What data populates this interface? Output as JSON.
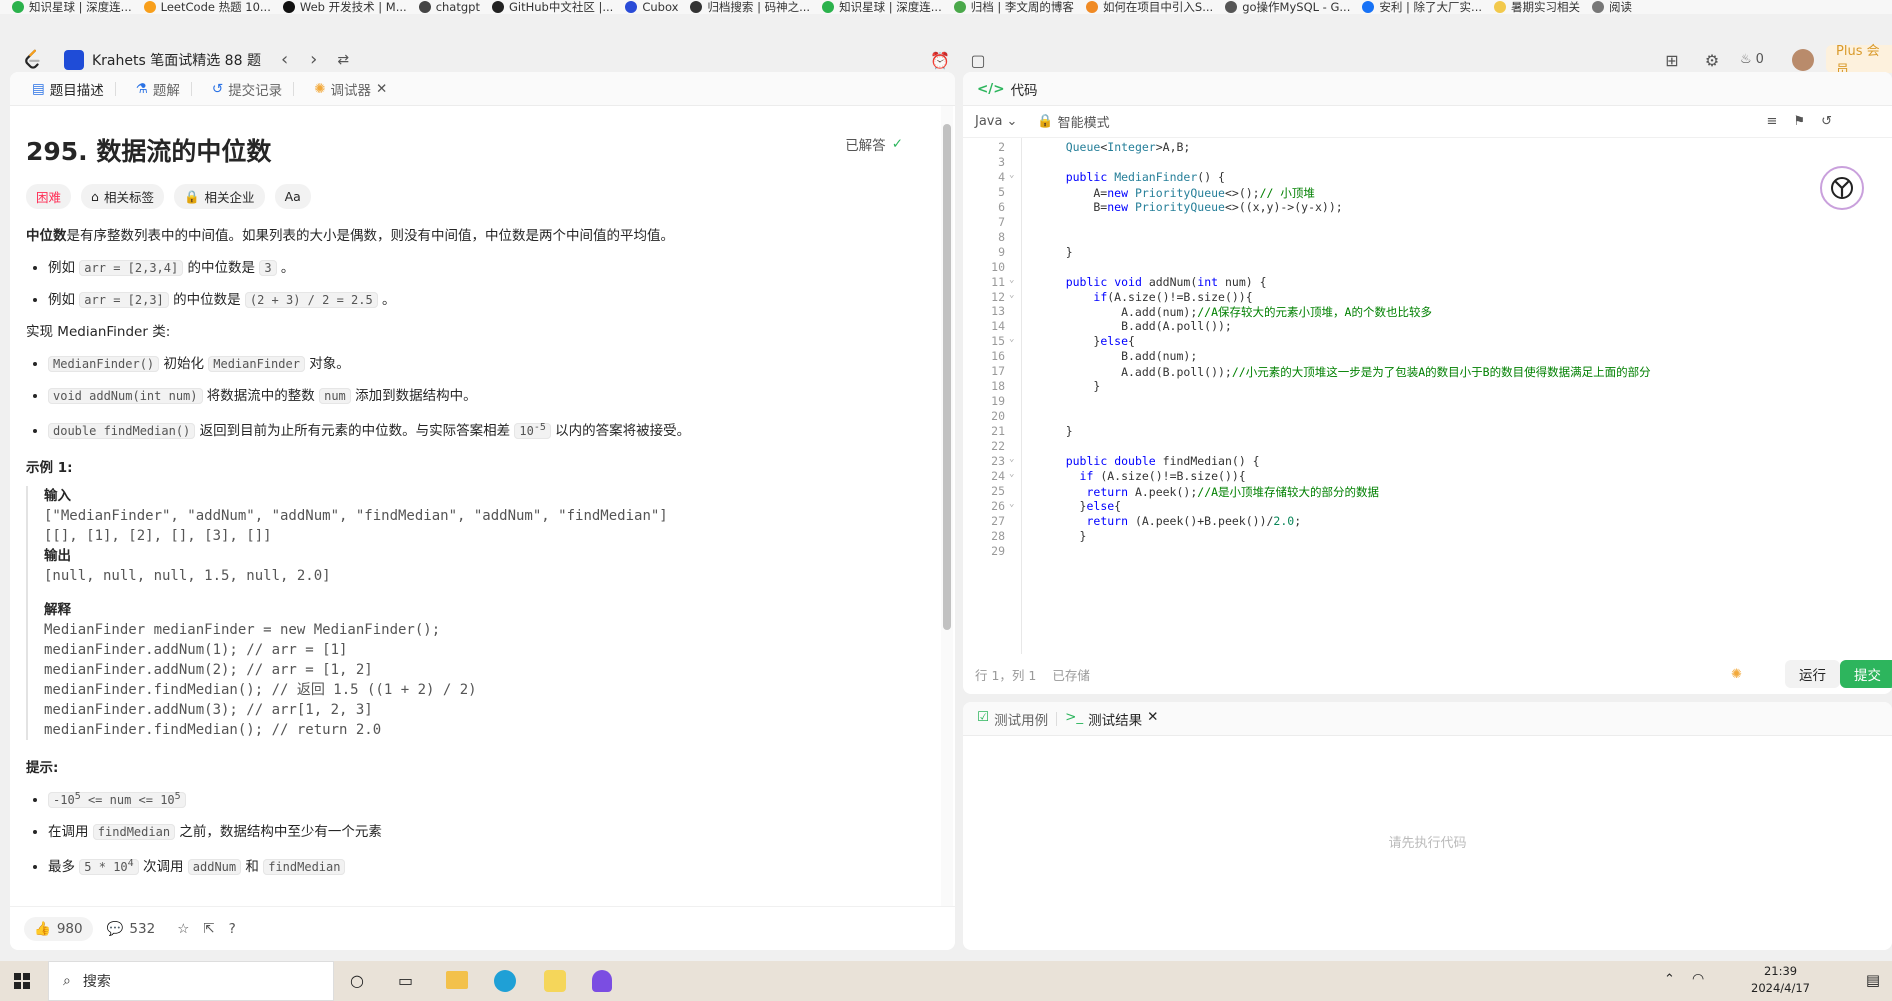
{
  "bookmarks": [
    {
      "label": "知识星球 | 深度连...",
      "color": "#2bb24c"
    },
    {
      "label": "LeetCode 热题 10...",
      "color": "#f89f1b"
    },
    {
      "label": "Web 开发技术 | M...",
      "color": "#111111"
    },
    {
      "label": "chatgpt",
      "color": "#444444"
    },
    {
      "label": "GitHub中文社区 |...",
      "color": "#222222"
    },
    {
      "label": "Cubox",
      "color": "#2a4bd7"
    },
    {
      "label": "归档搜索 | 码神之...",
      "color": "#333333"
    },
    {
      "label": "知识星球 | 深度连...",
      "color": "#2bb24c"
    },
    {
      "label": "归档 | 李文周的博客",
      "color": "#4aa84a"
    },
    {
      "label": "如何在项目中引入S...",
      "color": "#f08a24"
    },
    {
      "label": "go操作MySQL - G...",
      "color": "#555555"
    },
    {
      "label": "安利 | 除了大厂实...",
      "color": "#1772f6"
    },
    {
      "label": "暑期实习相关",
      "color": "#f2c94c"
    },
    {
      "label": "阅读",
      "color": "#777777"
    }
  ],
  "topnav": {
    "list_title": "Krahets 笔面试精选 88 题",
    "fire_count": "0",
    "plus_label": "Plus 会员"
  },
  "left_tabs": [
    {
      "label": "题目描述",
      "icon": "doc-icon"
    },
    {
      "label": "题解",
      "icon": "flask-icon"
    },
    {
      "label": "提交记录",
      "icon": "history-icon"
    },
    {
      "label": "调试器",
      "icon": "debug-icon"
    }
  ],
  "problem": {
    "title": "295. 数据流的中位数",
    "solved_label": "已解答",
    "difficulty": "困难",
    "chip_tags": "相关标签",
    "chip_company": "相关企业",
    "chip_font": "Aa",
    "intro_bold": "中位数",
    "intro_rest": "是有序整数列表中的中间值。如果列表的大小是偶数，则没有中间值，中位数是两个中间值的平均值。",
    "ex1_pre": "例如 ",
    "ex1_code": "arr = [2,3,4]",
    "ex1_mid": " 的中位数是 ",
    "ex1_val": "3",
    "ex1_end": " 。",
    "ex2_pre": "例如 ",
    "ex2_code": "arr = [2,3]",
    "ex2_mid": " 的中位数是 ",
    "ex2_val": "(2 + 3) / 2 = 2.5",
    "ex2_end": " 。",
    "impl_line": "实现 MedianFinder 类:",
    "m1_code": "MedianFinder()",
    "m1_text_a": " 初始化 ",
    "m1_code2": "MedianFinder",
    "m1_text_b": " 对象。",
    "m2_code": "void addNum(int num)",
    "m2_text_a": " 将数据流中的整数 ",
    "m2_code2": "num",
    "m2_text_b": " 添加到数据结构中。",
    "m3_code": "double findMedian()",
    "m3_text_a": " 返回到目前为止所有元素的中位数。与实际答案相差 ",
    "m3_code2": "10",
    "m3_sup": "-5",
    "m3_text_b": " 以内的答案将被接受。",
    "example_title": "示例 1:",
    "input_label": "输入",
    "input_line1": "[\"MedianFinder\", \"addNum\", \"addNum\", \"findMedian\", \"addNum\", \"findMedian\"]",
    "input_line2": "[[], [1], [2], [], [3], []]",
    "output_label": "输出",
    "output_line": "[null, null, null, 1.5, null, 2.0]",
    "explain_label": "解释",
    "explain_lines": [
      "MedianFinder medianFinder = new MedianFinder();",
      "medianFinder.addNum(1);    // arr = [1]",
      "medianFinder.addNum(2);    // arr = [1, 2]",
      "medianFinder.findMedian(); // 返回 1.5 ((1 + 2) / 2)",
      "medianFinder.addNum(3);    // arr[1, 2, 3]",
      "medianFinder.findMedian(); // return 2.0"
    ],
    "hints_title": "提示:",
    "h1_a": "-10",
    "h1_sup": "5",
    "h1_b": " <= num <= 10",
    "h1_sup2": "5",
    "h2_pre": "在调用 ",
    "h2_code": "findMedian",
    "h2_post": " 之前，数据结构中至少有一个元素",
    "h3_pre": "最多 ",
    "h3_code": "5 * 10",
    "h3_sup": "4",
    "h3_mid": " 次调用 ",
    "h3_code2": "addNum",
    "h3_and": " 和 ",
    "h3_code3": "findMedian"
  },
  "left_footer": {
    "likes": "980",
    "comments": "532"
  },
  "code_panel": {
    "title": "代码",
    "language": "Java",
    "mode": "智能模式",
    "status_pos": "行 1，列 1",
    "status_saved": "已存储",
    "run_label": "运行",
    "submit_label": "提交"
  },
  "code_lines": [
    {
      "n": "2",
      "t": "    Queue<Integer>A,B;"
    },
    {
      "n": "3",
      "t": ""
    },
    {
      "n": "4",
      "t": "    public MedianFinder() {",
      "fold": true
    },
    {
      "n": "5",
      "t": "        A=new PriorityQueue<>();// 小顶堆"
    },
    {
      "n": "6",
      "t": "        B=new PriorityQueue<>((x,y)->(y-x));"
    },
    {
      "n": "7",
      "t": ""
    },
    {
      "n": "8",
      "t": ""
    },
    {
      "n": "9",
      "t": "    }"
    },
    {
      "n": "10",
      "t": ""
    },
    {
      "n": "11",
      "t": "    public void addNum(int num) {",
      "fold": true
    },
    {
      "n": "12",
      "t": "        if(A.size()!=B.size()){",
      "fold": true
    },
    {
      "n": "13",
      "t": "            A.add(num);//A保存较大的元素小顶堆，A的个数也比较多"
    },
    {
      "n": "14",
      "t": "            B.add(A.poll());"
    },
    {
      "n": "15",
      "t": "        }else{",
      "fold": true
    },
    {
      "n": "16",
      "t": "            B.add(num);"
    },
    {
      "n": "17",
      "t": "            A.add(B.poll());//小元素的大顶堆这一步是为了包装A的数目小于B的数目使得数据满足上面的部分"
    },
    {
      "n": "18",
      "t": "        }"
    },
    {
      "n": "19",
      "t": ""
    },
    {
      "n": "20",
      "t": ""
    },
    {
      "n": "21",
      "t": "    }"
    },
    {
      "n": "22",
      "t": ""
    },
    {
      "n": "23",
      "t": "    public double findMedian() {",
      "fold": true
    },
    {
      "n": "24",
      "t": "      if (A.size()!=B.size()){",
      "fold": true
    },
    {
      "n": "25",
      "t": "       return A.peek();//A是小顶堆存储较大的部分的数据"
    },
    {
      "n": "26",
      "t": "      }else{",
      "fold": true
    },
    {
      "n": "27",
      "t": "       return (A.peek()+B.peek())/2.0;"
    },
    {
      "n": "28",
      "t": "      }"
    },
    {
      "n": "29",
      "t": ""
    }
  ],
  "test_panel": {
    "tab_cases": "测试用例",
    "tab_result": "测试结果",
    "empty_text": "请先执行代码"
  },
  "taskbar": {
    "search_placeholder": "搜索",
    "time": "21:39",
    "date": "2024/4/17"
  }
}
